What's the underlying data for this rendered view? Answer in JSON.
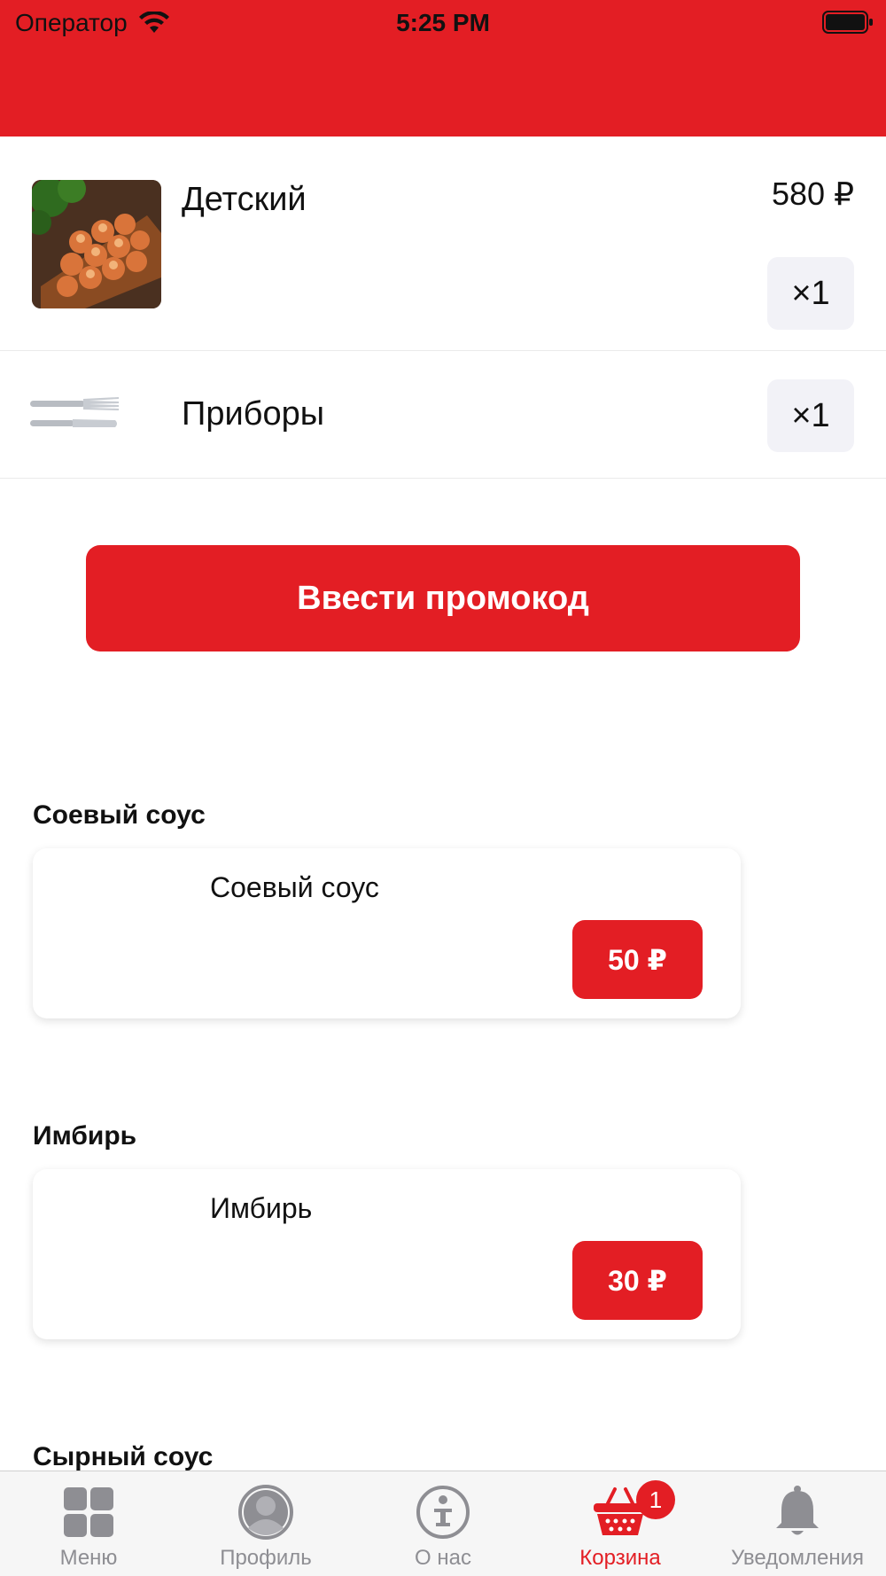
{
  "status_bar": {
    "carrier": "Оператор",
    "time": "5:25 PM"
  },
  "cart": {
    "items": [
      {
        "name": "Детский",
        "price": "580 ₽",
        "qty": "×1"
      },
      {
        "name": "Приборы",
        "qty": "×1"
      }
    ]
  },
  "promo_button": "Ввести промокод",
  "additions": [
    {
      "title": "Соевый соус",
      "card_name": "Соевый соус",
      "price": "50 ₽"
    },
    {
      "title": "Имбирь",
      "card_name": "Имбирь",
      "price": "30 ₽"
    },
    {
      "title": "Сырный соус"
    }
  ],
  "tab_bar": {
    "tabs": [
      {
        "label": "Меню",
        "icon": "grid-icon"
      },
      {
        "label": "Профиль",
        "icon": "profile-icon"
      },
      {
        "label": "О нас",
        "icon": "info-icon"
      },
      {
        "label": "Корзина",
        "icon": "basket-icon",
        "badge": "1",
        "active": true
      },
      {
        "label": "Уведомления",
        "icon": "bell-icon"
      }
    ]
  },
  "colors": {
    "accent": "#e31e24",
    "tab_inactive": "#8e8e93",
    "qty_bg": "#f2f2f7"
  }
}
